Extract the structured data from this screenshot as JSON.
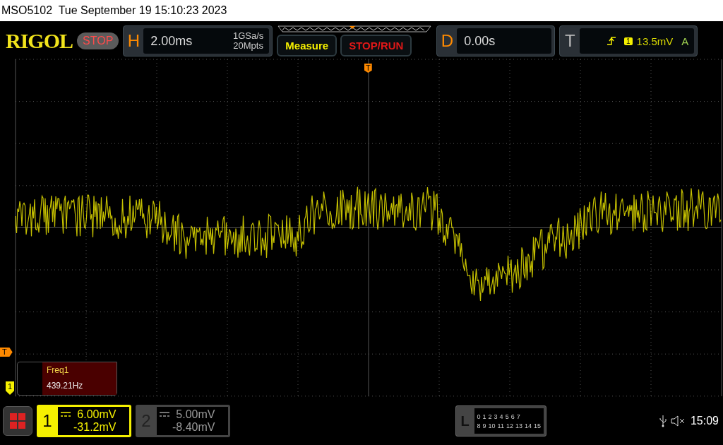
{
  "title_bar": {
    "text": "MSO5102  Tue September 19 15:10:23 2023"
  },
  "header": {
    "logo": "RIGOL",
    "run_state": "STOP",
    "horizontal": {
      "label": "H",
      "timebase": "2.00ms",
      "sample_rate": "1GSa/s",
      "memory_depth": "20Mpts"
    },
    "measure_button": "Measure",
    "stop_run_button": "STOP/RUN",
    "delay": {
      "label": "D",
      "value": "0.00s"
    },
    "trigger": {
      "label": "T",
      "source": "1",
      "level": "13.5mV",
      "mode": "A"
    }
  },
  "markers": {
    "trigger_position": "T",
    "trigger_level": "T",
    "channel_ground": "1"
  },
  "measurement": {
    "name": "Freq1",
    "value": "439.21Hz"
  },
  "channels": [
    {
      "number": "1",
      "scale": "6.00mV",
      "offset": "-31.2mV",
      "on": true
    },
    {
      "number": "2",
      "scale": "5.00mV",
      "offset": "-8.40mV",
      "on": false
    }
  ],
  "logic": {
    "label": "L",
    "row_1": [
      "0",
      "1",
      "2",
      "3",
      "4",
      "5",
      "6",
      "7"
    ],
    "row_2": [
      "8",
      "9",
      "10",
      "11",
      "12",
      "13",
      "14",
      "15"
    ]
  },
  "status": {
    "time": "15:09"
  }
}
